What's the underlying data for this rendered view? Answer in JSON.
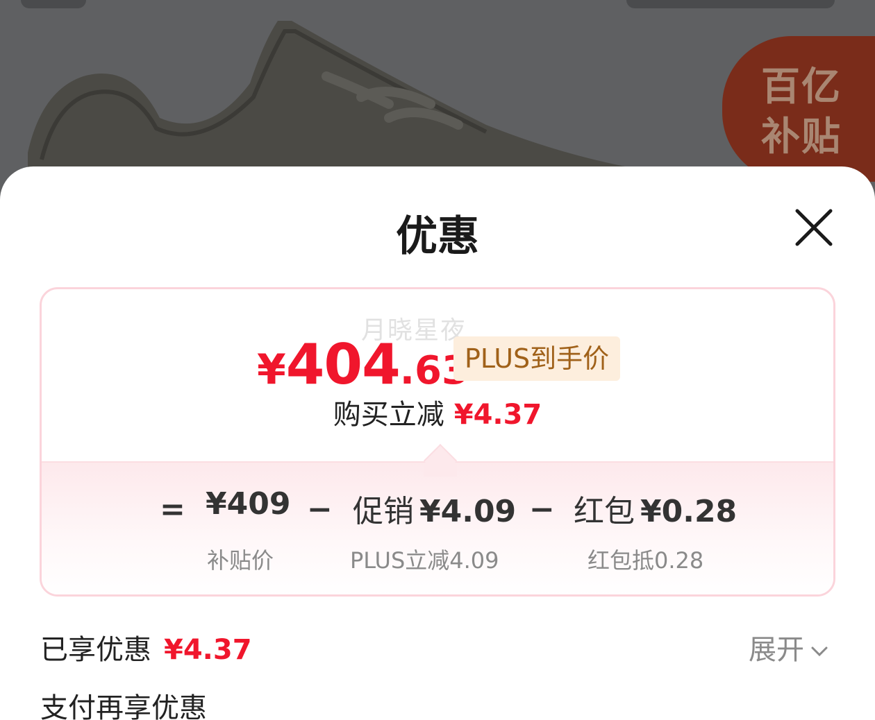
{
  "backdrop": {
    "badge_line1": "百亿",
    "badge_line2": "补贴"
  },
  "sheet": {
    "title": "优惠"
  },
  "price_card": {
    "watermark": "月晓星夜",
    "final_currency": "¥",
    "final_integer": "404",
    "final_decimal": ".63",
    "final_tag": "PLUS到手价",
    "reduce_label": "购买立减",
    "reduce_amount": "¥4.37",
    "breakdown": {
      "equals": "=",
      "base_amount": "¥409",
      "base_label": "补贴价",
      "minus1": "−",
      "promo_prefix": "促销",
      "promo_amount": "¥4.09",
      "promo_label": "PLUS立减4.09",
      "minus2": "−",
      "redpack_prefix": "红包",
      "redpack_amount": "¥0.28",
      "redpack_label": "红包抵0.28"
    }
  },
  "enjoyed": {
    "label": "已享优惠",
    "amount": "¥4.37",
    "expand_label": "展开"
  },
  "pay": {
    "label": "支付再享优惠"
  },
  "colors": {
    "accent_red": "#f0162c",
    "plus_gold": "#a06119",
    "plus_bg": "#fdeedd",
    "card_border": "#fbd4db"
  }
}
